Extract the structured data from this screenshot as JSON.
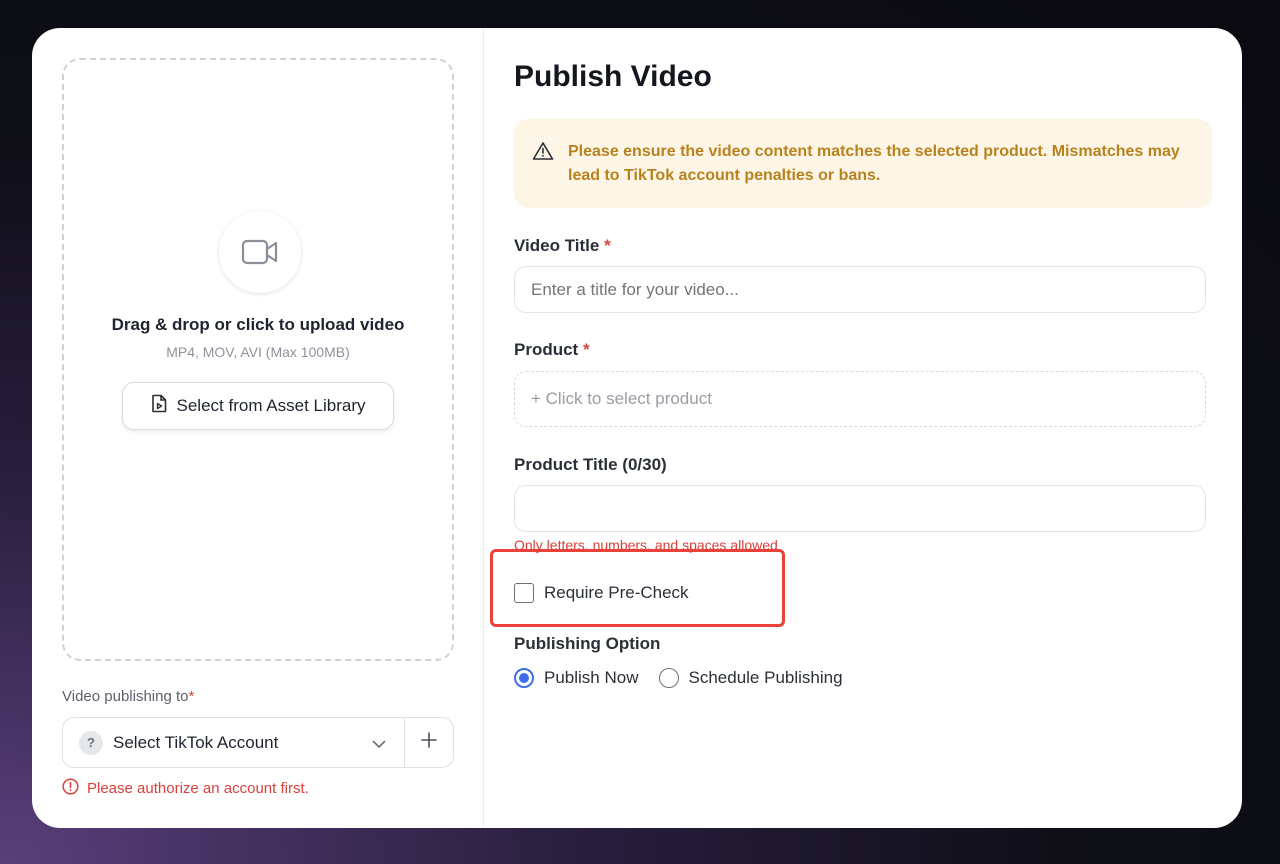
{
  "upload": {
    "icon": "video-camera-icon",
    "title": "Drag & drop or click to upload video",
    "subtitle": "MP4, MOV, AVI (Max 100MB)",
    "asset_button_label": "Select from Asset Library",
    "asset_button_icon": "file-video-icon"
  },
  "account": {
    "label": "Video publishing to",
    "required_mark": "*",
    "badge": "?",
    "select_label": "Select TikTok Account",
    "error": "Please authorize an account first."
  },
  "form": {
    "title": "Publish Video",
    "warning": "Please ensure the video content matches the selected product. Mismatches may lead to TikTok account penalties or bans.",
    "video_title_label": "Video Title",
    "video_title_placeholder": "Enter a title for your video...",
    "required_mark": "*",
    "product_label": "Product",
    "product_placeholder": "+ Click to select product",
    "product_title_label": "Product Title (0/30)",
    "product_title_value": "",
    "product_title_hint": "Only letters, numbers, and spaces allowed",
    "precheck_label": "Require Pre-Check",
    "precheck_checked": false,
    "publishing_option_label": "Publishing Option",
    "publish_now_label": "Publish Now",
    "schedule_label": "Schedule Publishing",
    "selected_option": "Publish Now"
  },
  "colors": {
    "accent": "#3b6ee8",
    "error": "#d9413b",
    "warning_text": "#b8821f",
    "warning_bg": "#fdf6e7",
    "highlight": "#e8423b"
  }
}
